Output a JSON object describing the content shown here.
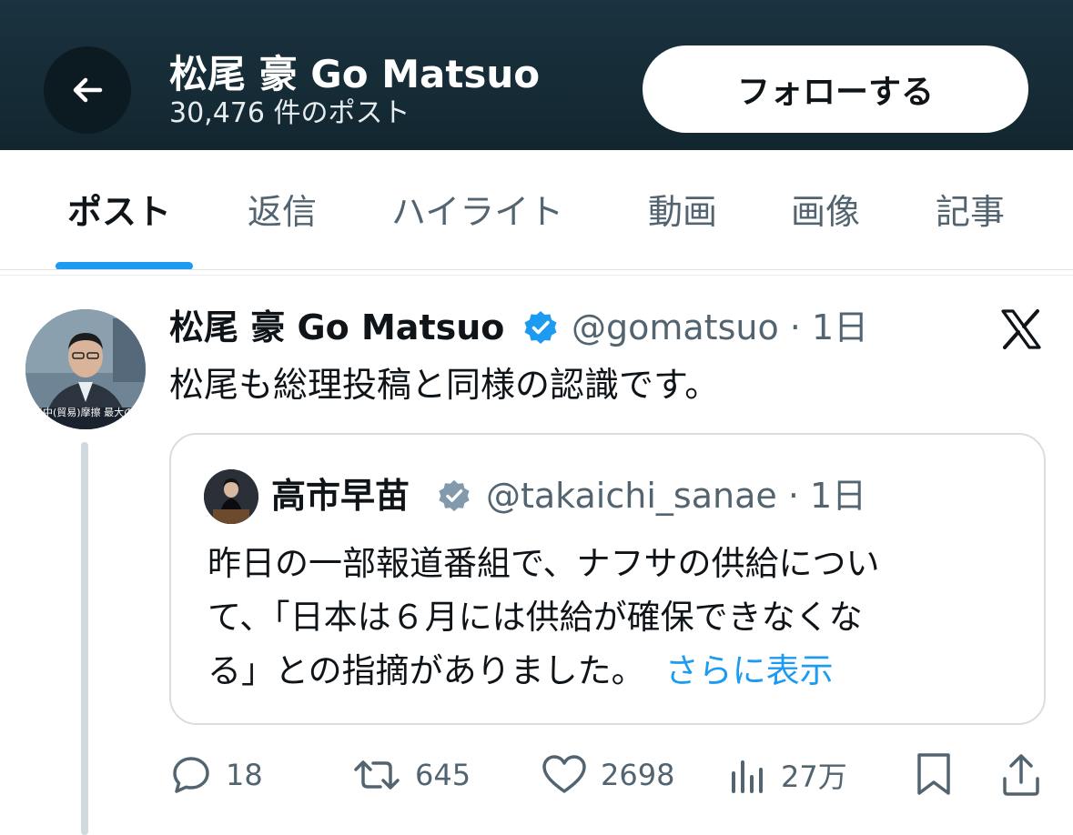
{
  "header": {
    "name": "松尾 豪 Go Matsuo",
    "post_count": "30,476 件のポスト",
    "follow_label": "フォローする"
  },
  "tabs": [
    {
      "label": "ポスト",
      "active": true
    },
    {
      "label": "返信"
    },
    {
      "label": "ハイライト"
    },
    {
      "label": "動画"
    },
    {
      "label": "画像"
    },
    {
      "label": "記事"
    }
  ],
  "post": {
    "author_name": "松尾 豪 Go Matsuo",
    "handle_time": "@gomatsuo · 1日",
    "text": "松尾も総理投稿と同様の認識です。",
    "avatar_caption": "米中(貿易)摩擦 最大のLNG",
    "quote": {
      "author_name": "高市早苗",
      "handle_time": "@takaichi_sanae · 1日",
      "lines": [
        "昨日の一部報道番組で、ナフサの供給につい",
        "て、「日本は６月には供給が確保できなくな",
        "る」との指摘がありました。"
      ],
      "show_more": "さらに表示"
    },
    "actions": {
      "replies": "18",
      "reposts": "645",
      "likes": "2698",
      "views": "27万"
    }
  },
  "colors": {
    "header_bg": "#1a3340",
    "accent": "#1d9bf0",
    "verified": "#1d9bf0",
    "quote_verified": "#829aab"
  },
  "icons": [
    "back-arrow-icon",
    "verified-badge-icon",
    "x-logo-icon",
    "reply-icon",
    "repost-icon",
    "like-icon",
    "views-icon",
    "bookmark-icon",
    "share-icon"
  ]
}
